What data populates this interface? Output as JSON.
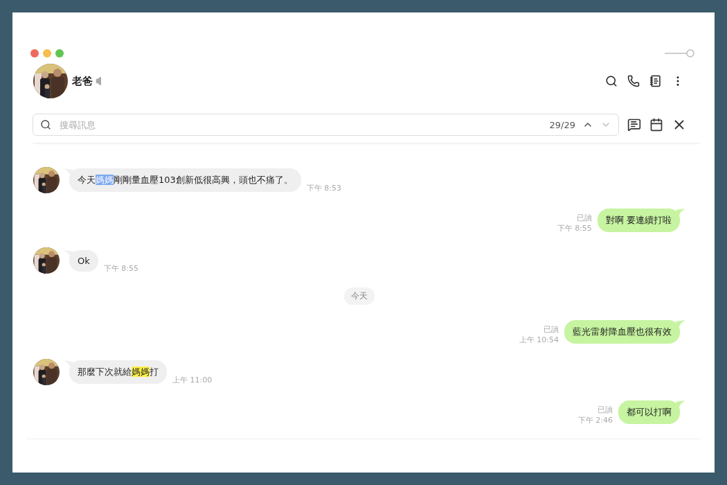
{
  "chat": {
    "name": "老爸"
  },
  "search": {
    "placeholder": "搜尋訊息",
    "count": "29/29",
    "up_disabled": false,
    "down_disabled": true
  },
  "messages": [
    {
      "kind": "received",
      "segments": [
        {
          "text": "今天"
        },
        {
          "text": "媽媽",
          "highlighted": true,
          "current": true
        },
        {
          "text": "剛剛量血壓103創新低很高興，頭也不痛了。"
        }
      ],
      "time": "下午 8:53"
    },
    {
      "kind": "sent",
      "segments": [
        {
          "text": "對啊 要連續打啦"
        }
      ],
      "read": "已讀",
      "time": "下午 8:55"
    },
    {
      "kind": "received",
      "segments": [
        {
          "text": "Ok"
        }
      ],
      "time": "下午 8:55"
    },
    {
      "kind": "date",
      "label": "今天"
    },
    {
      "kind": "sent",
      "segments": [
        {
          "text": "藍光雷射降血壓也很有效"
        }
      ],
      "read": "已讀",
      "time": "上午 10:54"
    },
    {
      "kind": "received",
      "segments": [
        {
          "text": "那麼下次就給"
        },
        {
          "text": "媽媽",
          "highlighted": true,
          "current": false
        },
        {
          "text": "打"
        }
      ],
      "time": "上午 11:00"
    },
    {
      "kind": "sent",
      "segments": [
        {
          "text": "都可以打啊"
        }
      ],
      "read": "已讀",
      "time": "下午 2:46"
    }
  ]
}
